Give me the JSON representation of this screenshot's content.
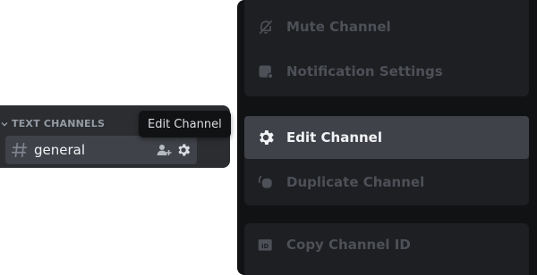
{
  "sidebar": {
    "category_label": "TEXT CHANNELS",
    "channel_name": "general",
    "tooltip": "Edit Channel"
  },
  "context_menu": {
    "items": [
      {
        "label": "Mute Channel",
        "icon": "bell-slash-icon"
      },
      {
        "label": "Notification Settings",
        "icon": "notification-icon"
      },
      {
        "label": "Edit Channel",
        "icon": "gear-icon",
        "active": true
      },
      {
        "label": "Duplicate Channel",
        "icon": "duplicate-icon"
      },
      {
        "label": "Copy Channel ID",
        "icon": "id-icon"
      }
    ]
  },
  "colors": {
    "sidebar_bg": "#2b2d31",
    "selected_bg": "#404249",
    "menu_bg": "#111214",
    "menu_group_bg": "#1e1f22",
    "muted_text": "#4e5058",
    "bright_text": "#f2f3f5"
  }
}
